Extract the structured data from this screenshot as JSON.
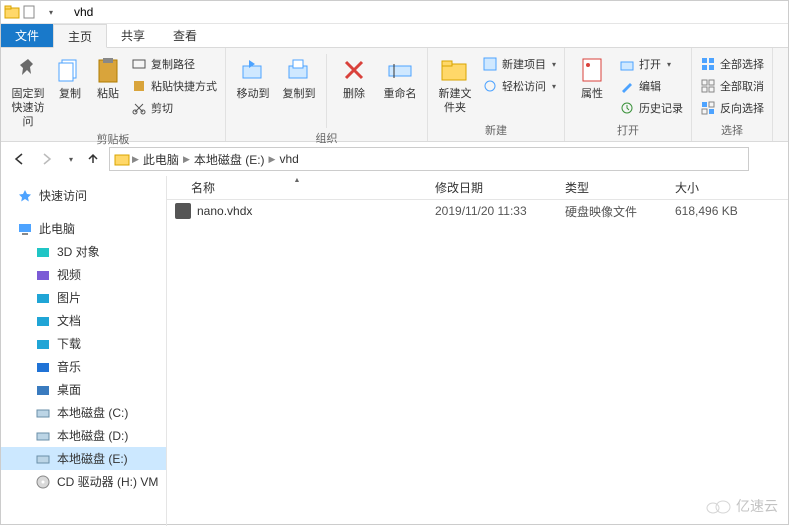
{
  "titlebar": {
    "title": "vhd"
  },
  "tabs": {
    "file": "文件",
    "home": "主页",
    "share": "共享",
    "view": "查看"
  },
  "ribbon": {
    "clipboard": {
      "label": "剪贴板",
      "pin": "固定到快速访问",
      "copy": "复制",
      "paste": "粘贴",
      "copy_path": "复制路径",
      "paste_shortcut": "粘贴快捷方式",
      "cut": "剪切"
    },
    "organize": {
      "label": "组织",
      "move_to": "移动到",
      "copy_to": "复制到",
      "delete": "删除",
      "rename": "重命名"
    },
    "new": {
      "label": "新建",
      "new_folder": "新建文件夹",
      "new_item": "新建项目",
      "easy_access": "轻松访问"
    },
    "open": {
      "label": "打开",
      "properties": "属性",
      "open": "打开",
      "edit": "编辑",
      "history": "历史记录"
    },
    "select": {
      "label": "选择",
      "select_all": "全部选择",
      "select_none": "全部取消",
      "invert": "反向选择"
    }
  },
  "breadcrumb": {
    "items": [
      "此电脑",
      "本地磁盘 (E:)",
      "vhd"
    ]
  },
  "navpane": {
    "quick_access": "快速访问",
    "this_pc": "此电脑",
    "items": [
      {
        "label": "3D 对象"
      },
      {
        "label": "视频"
      },
      {
        "label": "图片"
      },
      {
        "label": "文档"
      },
      {
        "label": "下载"
      },
      {
        "label": "音乐"
      },
      {
        "label": "桌面"
      },
      {
        "label": "本地磁盘 (C:)"
      },
      {
        "label": "本地磁盘 (D:)"
      },
      {
        "label": "本地磁盘 (E:)",
        "selected": true
      },
      {
        "label": "CD 驱动器 (H:) VM"
      }
    ]
  },
  "columns": {
    "name": "名称",
    "date": "修改日期",
    "type": "类型",
    "size": "大小"
  },
  "files": [
    {
      "name": "nano.vhdx",
      "date": "2019/11/20 11:33",
      "type": "硬盘映像文件",
      "size": "618,496 KB"
    }
  ],
  "watermark": "亿速云"
}
